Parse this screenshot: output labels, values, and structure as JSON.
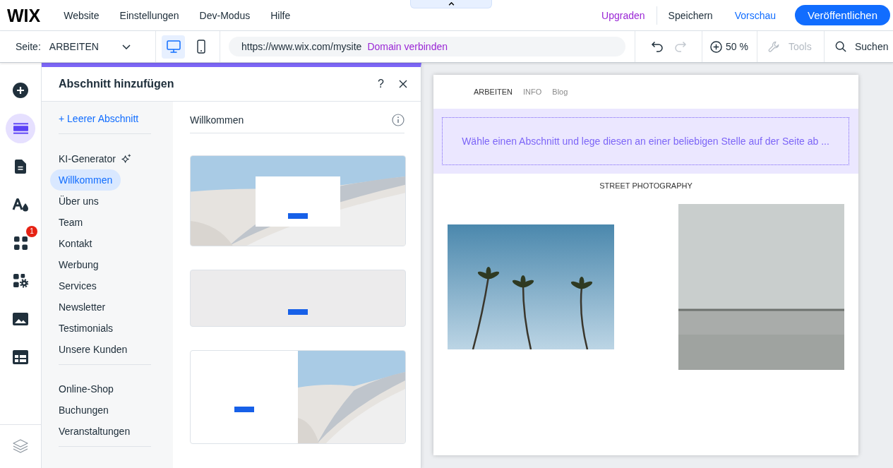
{
  "top_bar": {
    "logo": "WIX",
    "menu": [
      "Website",
      "Einstellungen",
      "Dev-Modus",
      "Hilfe"
    ],
    "actions": [
      {
        "label": "Upgraden",
        "kind": "upgrade"
      },
      {
        "label": "Speichern",
        "kind": "save"
      },
      {
        "label": "Vorschau",
        "kind": "preview"
      },
      {
        "label": "Veröffentlichen",
        "kind": "publish"
      }
    ]
  },
  "toolbar": {
    "page_label": "Seite:",
    "page": "ARBEITEN",
    "devices": [
      {
        "kind": "desktop",
        "selected": true
      },
      {
        "kind": "mobile",
        "selected": false
      }
    ],
    "address": {
      "url": "https://www.wix.com/mysite",
      "link": "Domain verbinden"
    },
    "history": [
      {
        "kind": "undo",
        "disabled": false
      },
      {
        "kind": "redo",
        "disabled": true
      }
    ],
    "zoom": "50 %",
    "tools": {
      "label": "Tools",
      "disabled": true
    },
    "search": "Suchen"
  },
  "sidebar": {
    "items": [
      {
        "kind": "add",
        "selected": false
      },
      {
        "kind": "sections",
        "selected": true
      },
      {
        "kind": "pages",
        "selected": false
      },
      {
        "kind": "design",
        "selected": false
      },
      {
        "kind": "apps",
        "selected": false,
        "badge": "1"
      },
      {
        "kind": "business",
        "selected": false
      },
      {
        "kind": "media",
        "selected": false
      },
      {
        "kind": "cms",
        "selected": false
      }
    ],
    "bottom_items": [
      {
        "kind": "layers",
        "selected": false
      }
    ]
  },
  "panel": {
    "title": "Abschnitt hinzufügen",
    "help": "?",
    "blank_section": "+ Leerer Abschnitt",
    "category_groups": [
      {
        "items": [
          {
            "label": "KI-Generator",
            "kind": "ai",
            "selected": false
          },
          {
            "label": "Willkommen",
            "kind": "plain",
            "selected": true
          },
          {
            "label": "Über uns",
            "kind": "plain",
            "selected": false
          },
          {
            "label": "Team",
            "kind": "plain",
            "selected": false
          },
          {
            "label": "Kontakt",
            "kind": "plain",
            "selected": false
          },
          {
            "label": "Werbung",
            "kind": "plain",
            "selected": false
          },
          {
            "label": "Services",
            "kind": "plain",
            "selected": false
          },
          {
            "label": "Newsletter",
            "kind": "plain",
            "selected": false
          },
          {
            "label": "Testimonials",
            "kind": "plain",
            "selected": false
          },
          {
            "label": "Unsere Kunden",
            "kind": "plain",
            "selected": false
          }
        ]
      },
      {
        "items": [
          {
            "label": "Online-Shop",
            "kind": "plain",
            "selected": false
          },
          {
            "label": "Buchungen",
            "kind": "plain",
            "selected": false
          },
          {
            "label": "Veranstaltungen",
            "kind": "plain",
            "selected": false
          }
        ]
      }
    ],
    "heading": "Willkommen",
    "templates": [
      {
        "kind": "photo-box"
      },
      {
        "kind": "plain"
      },
      {
        "kind": "split"
      }
    ]
  },
  "canvas": {
    "site_nav": [
      {
        "label": "ARBEITEN",
        "selected": true
      },
      {
        "label": "INFO",
        "selected": false
      },
      {
        "label": "Blog",
        "selected": false
      }
    ],
    "drop_hint": "Wähle einen Abschnitt und lege diesen an einer beliebigen Stelle auf der Seite ab ...",
    "heading": "STREET PHOTOGRAPHY",
    "photos": [
      {
        "kind": "palms"
      },
      {
        "kind": "wall"
      }
    ]
  }
}
